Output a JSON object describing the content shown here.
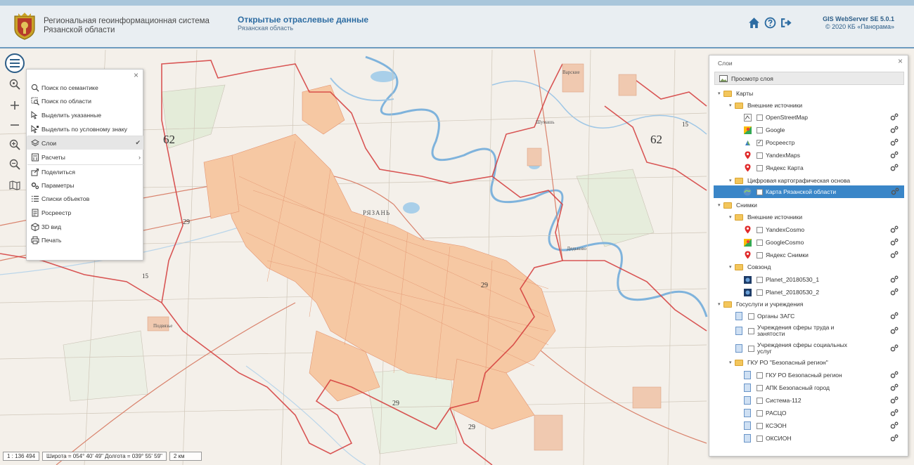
{
  "header": {
    "system_title_line1": "Региональная геоинформационная система",
    "system_title_line2": "Рязанской области",
    "section_title": "Открытые отраслевые данные",
    "section_subtitle": "Рязанская область",
    "version": "GIS WebServer SE 5.0.1",
    "copyright": "© 2020 КБ «Панорама»",
    "icons": [
      "home-icon",
      "help-icon",
      "logout-icon"
    ]
  },
  "map": {
    "city_label": "РЯЗАНЬ",
    "zone_labels": [
      "62",
      "62",
      "29",
      "29",
      "29",
      "29",
      "15",
      "15"
    ],
    "place_labels": [
      "Варские",
      "Шумашь",
      "Дядьково",
      "Подвязье"
    ]
  },
  "menu": {
    "items": [
      {
        "label": "Поиск по семантике",
        "icon": "semantic-search-icon"
      },
      {
        "label": "Поиск по области",
        "icon": "area-search-icon"
      },
      {
        "label": "Выделить указанные",
        "icon": "select-icon"
      },
      {
        "label": "Выделить по условному знаку",
        "icon": "select-by-sign-icon"
      },
      {
        "label": "Слои",
        "icon": "layers-icon",
        "selected": true,
        "mark": "✔"
      },
      {
        "label": "Расчеты",
        "icon": "calc-icon",
        "mark": "›"
      },
      {
        "label": "Поделиться",
        "icon": "share-icon"
      },
      {
        "label": "Параметры",
        "icon": "settings-icon"
      },
      {
        "label": "Списки объектов",
        "icon": "list-icon"
      },
      {
        "label": "Росреестр",
        "icon": "rosreestr-icon"
      },
      {
        "label": "3D вид",
        "icon": "cube-icon"
      },
      {
        "label": "Печать",
        "icon": "print-icon"
      }
    ]
  },
  "layers": {
    "title": "Слои",
    "preview_label": "Просмотр слоя",
    "rows": [
      {
        "label": "Карты",
        "kind": "folder",
        "level": 0
      },
      {
        "label": "Внешние источники",
        "kind": "folder",
        "level": 1
      },
      {
        "label": "OpenStreetMap",
        "kind": "layer",
        "level": 2,
        "checked": false,
        "icon": "osm-icon"
      },
      {
        "label": "Google",
        "kind": "layer",
        "level": 2,
        "checked": false,
        "icon": "google-maps-icon"
      },
      {
        "label": "Росреестр",
        "kind": "layer",
        "level": 2,
        "checked": true,
        "icon": "rosreestr-icon"
      },
      {
        "label": "YandexMaps",
        "kind": "layer",
        "level": 2,
        "checked": false,
        "icon": "yandex-pin-icon"
      },
      {
        "label": "Яндекс Карта",
        "kind": "layer",
        "level": 2,
        "checked": false,
        "icon": "yandex-pin-icon"
      },
      {
        "label": "Цифровая картографическая основа",
        "kind": "folder",
        "level": 1
      },
      {
        "label": "Карта Рязанской области",
        "kind": "layer",
        "level": 2,
        "checked": true,
        "icon": "map-layer-icon",
        "highlighted": true
      },
      {
        "label": "Снимки",
        "kind": "folder",
        "level": 0
      },
      {
        "label": "Внешние источники",
        "kind": "folder",
        "level": 1
      },
      {
        "label": "YandexCosmo",
        "kind": "layer",
        "level": 2,
        "checked": false,
        "icon": "yandex-pin-icon"
      },
      {
        "label": "GoogleCosmo",
        "kind": "layer",
        "level": 2,
        "checked": false,
        "icon": "google-maps-icon"
      },
      {
        "label": "Яндекс Снимки",
        "kind": "layer",
        "level": 2,
        "checked": false,
        "icon": "yandex-pin-icon"
      },
      {
        "label": "Совзонд",
        "kind": "folder",
        "level": 1
      },
      {
        "label": "Planet_20180530_1",
        "kind": "layer",
        "level": 2,
        "checked": false,
        "icon": "satellite-icon"
      },
      {
        "label": "Planet_20180530_2",
        "kind": "layer",
        "level": 2,
        "checked": false,
        "icon": "satellite-icon"
      },
      {
        "label": "Госуслуги и учреждения",
        "kind": "folder",
        "level": 0
      },
      {
        "label": "Органы ЗАГС",
        "kind": "layer",
        "level": 1,
        "checked": false,
        "icon": "document-icon"
      },
      {
        "label": "Учреждения сферы труда и занятости",
        "kind": "layer",
        "level": 1,
        "checked": false,
        "icon": "document-icon",
        "two_line": true
      },
      {
        "label": "Учреждения сферы социальных услуг",
        "kind": "layer",
        "level": 1,
        "checked": false,
        "icon": "document-icon",
        "two_line": true
      },
      {
        "label": "ГКУ РО \"Безопасный регион\"",
        "kind": "folder",
        "level": 1
      },
      {
        "label": "ГКУ РО Безопасный регион",
        "kind": "layer",
        "level": 2,
        "checked": false,
        "icon": "document-icon"
      },
      {
        "label": "АПК Безопасный город",
        "kind": "layer",
        "level": 2,
        "checked": false,
        "icon": "document-icon"
      },
      {
        "label": "Система-112",
        "kind": "layer",
        "level": 2,
        "checked": false,
        "icon": "document-icon"
      },
      {
        "label": "РАСЦО",
        "kind": "layer",
        "level": 2,
        "checked": false,
        "icon": "document-icon"
      },
      {
        "label": "КСЭОН",
        "kind": "layer",
        "level": 2,
        "checked": false,
        "icon": "document-icon"
      },
      {
        "label": "ОКСИОН",
        "kind": "layer",
        "level": 2,
        "checked": false,
        "icon": "document-icon"
      }
    ]
  },
  "status": {
    "scale": "1 : 136 494",
    "coords": "Широта = 054° 40' 49\" Долгота = 039° 55' 59\"",
    "scalebar": "2 км"
  }
}
